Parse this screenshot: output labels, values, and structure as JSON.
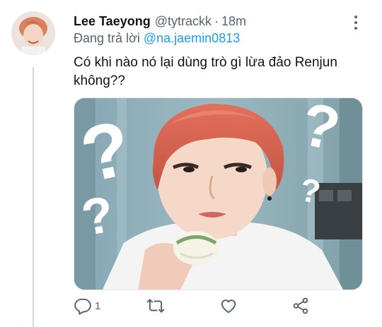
{
  "tweet": {
    "author_name": "Lee Taeyong",
    "author_handle": "@tytrackk",
    "separator": "·",
    "timestamp": "18m",
    "replying_prefix": "Đang trả lời",
    "replying_to": "@na.jaemin0813",
    "text_line1": "Có khi nào nó lại dùng trò gì lừa đảo Renjun",
    "text_line2": "không??",
    "media_icon": "photo",
    "reply_count": "1",
    "retweet_count": "",
    "like_count": ""
  },
  "icons": {
    "reply": "reply-icon",
    "retweet": "retweet-icon",
    "like": "heart-icon",
    "share": "share-icon",
    "more": "more-vertical-icon"
  },
  "colors": {
    "accent": "#1d9bf0",
    "text_primary": "#0f1419",
    "text_secondary": "#536471",
    "thread_line": "#cfd9de"
  }
}
